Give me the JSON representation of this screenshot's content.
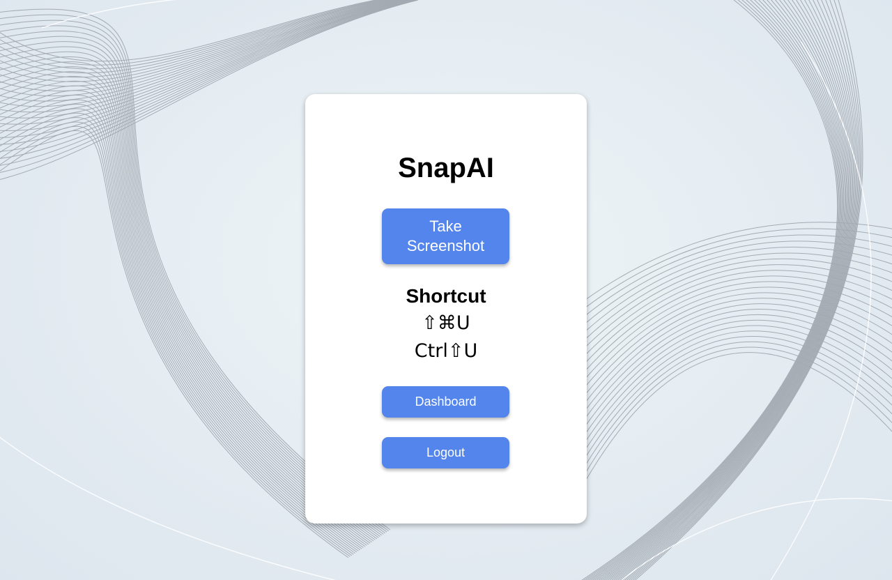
{
  "app": {
    "title": "SnapAI"
  },
  "actions": {
    "capture_label": "Take Screenshot",
    "dashboard_label": "Dashboard",
    "logout_label": "Logout"
  },
  "shortcut": {
    "heading": "Shortcut",
    "mac": "⇧⌘U",
    "windows": "Ctrl⇧U"
  },
  "colors": {
    "accent": "#5385ec",
    "card": "#ffffff",
    "background": "#e6eef3",
    "wave_lines": "#8e959d"
  }
}
